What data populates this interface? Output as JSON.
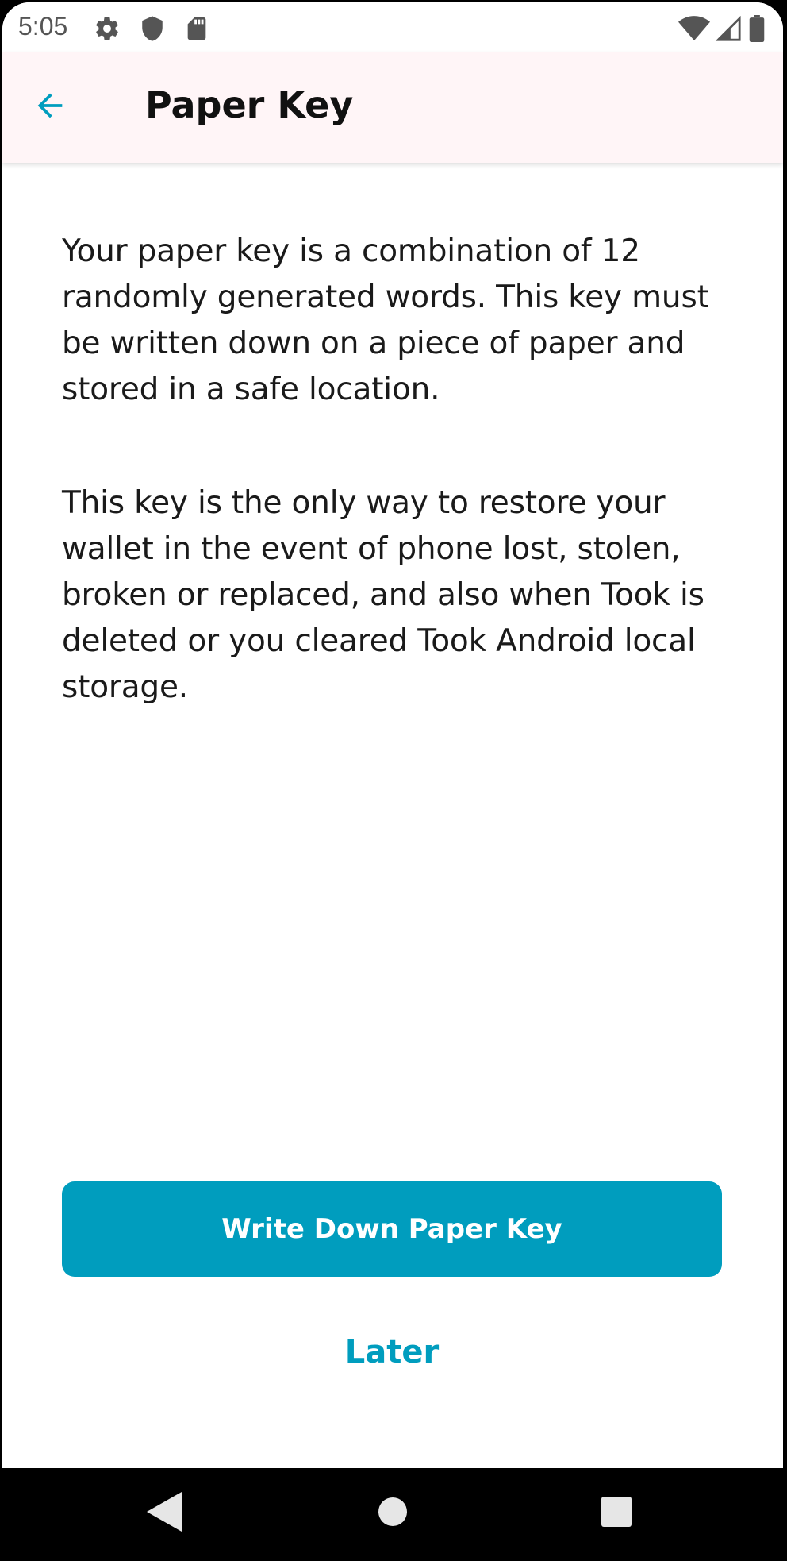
{
  "status_bar": {
    "time": "5:05",
    "left_icons": [
      "gear-icon",
      "shield-icon",
      "sd-card-icon"
    ],
    "right_icons": [
      "wifi-icon",
      "cellular-signal-icon",
      "battery-icon"
    ]
  },
  "app_bar": {
    "back_icon": "back-arrow-icon",
    "title": "Paper Key"
  },
  "content": {
    "paragraphs": [
      "Your paper key is a combination of 12 randomly generated words. This key must be written down on a piece of paper and stored in a safe location.",
      "This key is the only way to restore your wallet in the event of phone lost, stolen, broken or replaced, and also when Took is deleted or you cleared Took Android local storage."
    ]
  },
  "actions": {
    "primary_label": "Write Down Paper Key",
    "secondary_label": "Later"
  },
  "nav_bar": {
    "buttons": [
      "nav-back-icon",
      "nav-home-icon",
      "nav-recents-icon"
    ]
  },
  "colors": {
    "accent": "#009dbe",
    "app_bar_bg": "#fff5f7",
    "text": "#1a1a1a"
  }
}
